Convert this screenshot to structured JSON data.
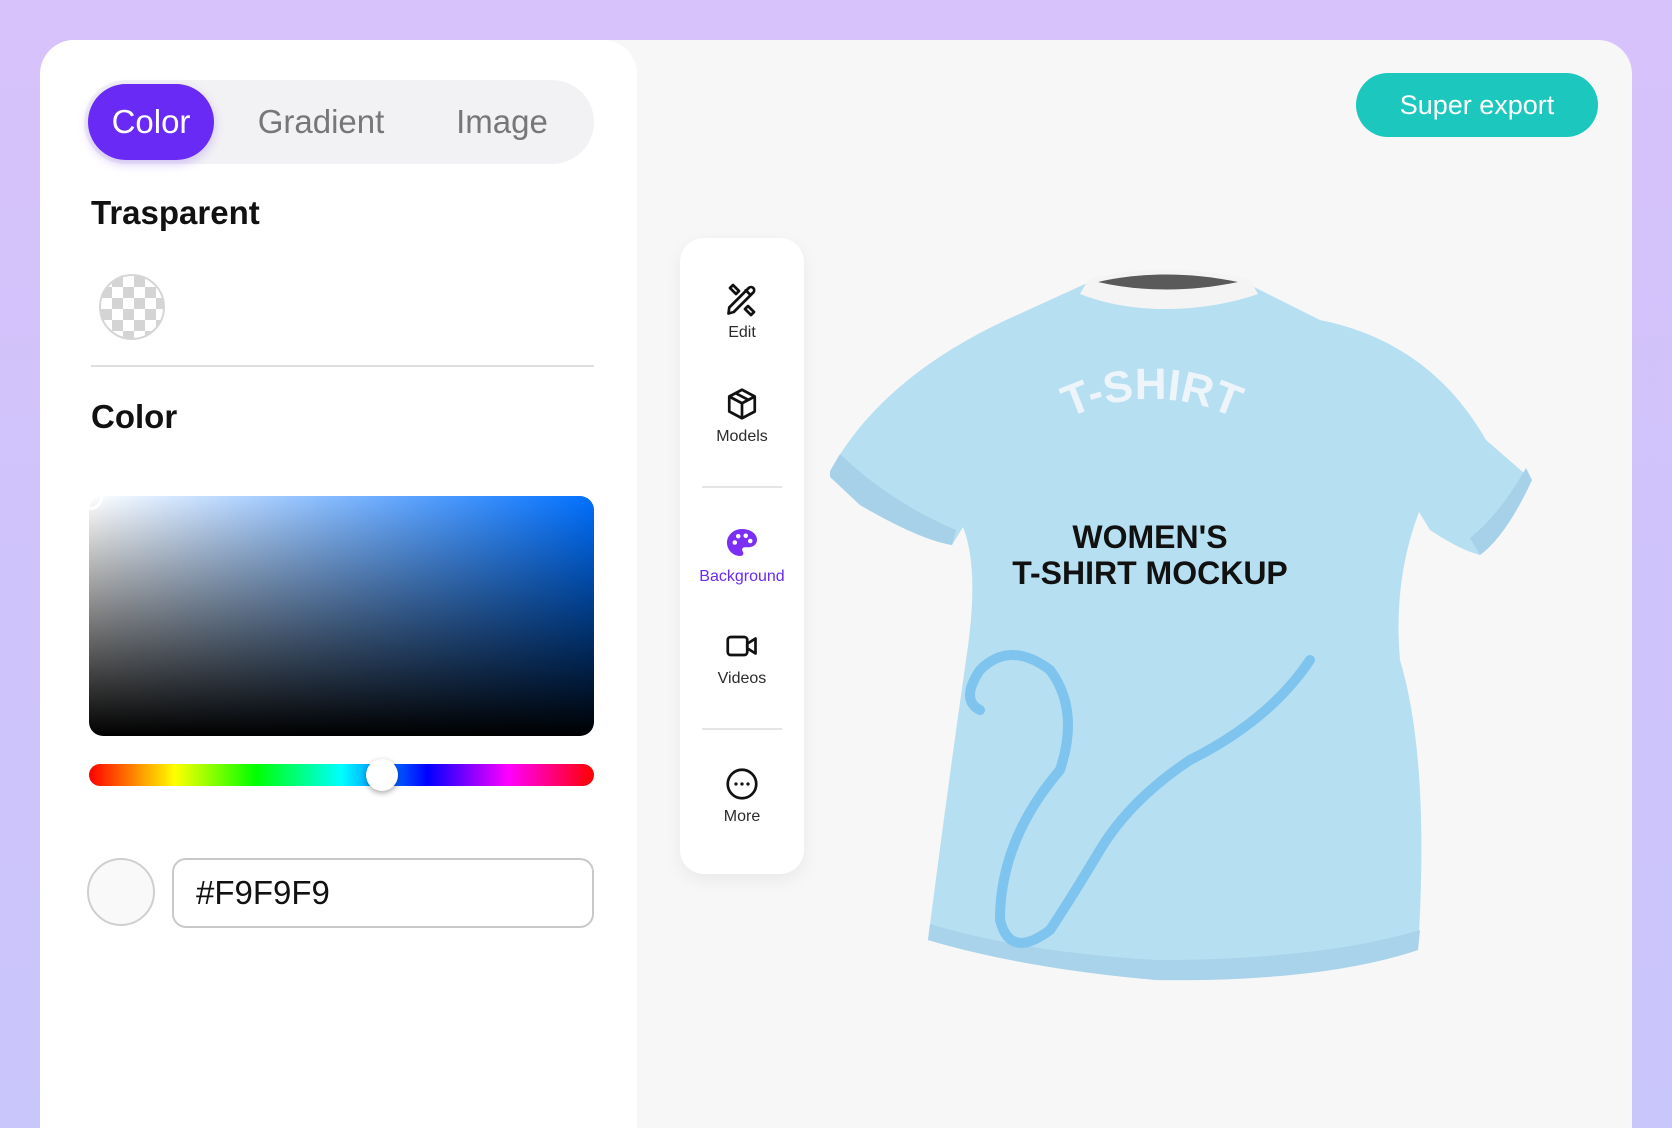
{
  "tabs": [
    {
      "label": "Color",
      "active": true
    },
    {
      "label": "Gradient",
      "active": false
    },
    {
      "label": "Image",
      "active": false
    }
  ],
  "transparent": {
    "title": "Trasparent"
  },
  "color_section": {
    "title": "Color",
    "hue_position": 0.58,
    "hex_value": "#F9F9F9",
    "preview_color": "#F9F9F9"
  },
  "toolbar": {
    "items": [
      {
        "label": "Edit",
        "icon": "edit-tools-icon",
        "active": false
      },
      {
        "label": "Models",
        "icon": "cube-icon",
        "active": false
      },
      {
        "label": "Background",
        "icon": "palette-icon",
        "active": true
      },
      {
        "label": "Videos",
        "icon": "video-camera-icon",
        "active": false
      },
      {
        "label": "More",
        "icon": "more-dots-icon",
        "active": false
      }
    ]
  },
  "export_button": {
    "label": "Super export"
  },
  "mockup": {
    "arc_text": "T-SHIRT",
    "line1": "WOMEN'S",
    "line2": "T-SHIRT MOCKUP",
    "shirt_color": "#b7dff2"
  },
  "colors": {
    "accent": "#6a2af5",
    "export": "#1cc8bd",
    "background": "#f7f7f7"
  }
}
